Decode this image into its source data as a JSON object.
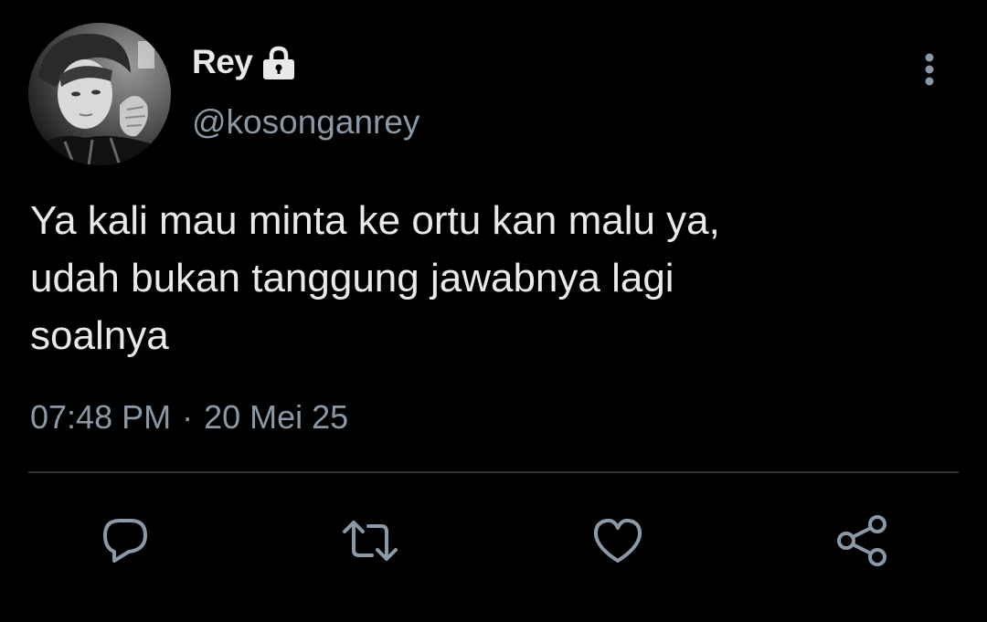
{
  "tweet": {
    "display_name": "Rey",
    "handle": "@kosonganrey",
    "text": "Ya kali mau minta ke ortu kan malu ya,\nudah bukan tanggung jawabnya lagi\nsoalnya",
    "time": "07:48 PM",
    "separator": "·",
    "date": "20 Mei 25",
    "protected_icon": "lock-icon",
    "more_icon": "more-vertical-icon"
  },
  "actions": [
    {
      "name": "reply",
      "icon": "reply-icon"
    },
    {
      "name": "retweet",
      "icon": "retweet-icon"
    },
    {
      "name": "like",
      "icon": "heart-icon"
    },
    {
      "name": "share",
      "icon": "share-icon"
    }
  ],
  "colors": {
    "background": "#000000",
    "primary_text": "#e7e9ea",
    "secondary_text": "#8b98a5",
    "divider": "#2f3336"
  }
}
